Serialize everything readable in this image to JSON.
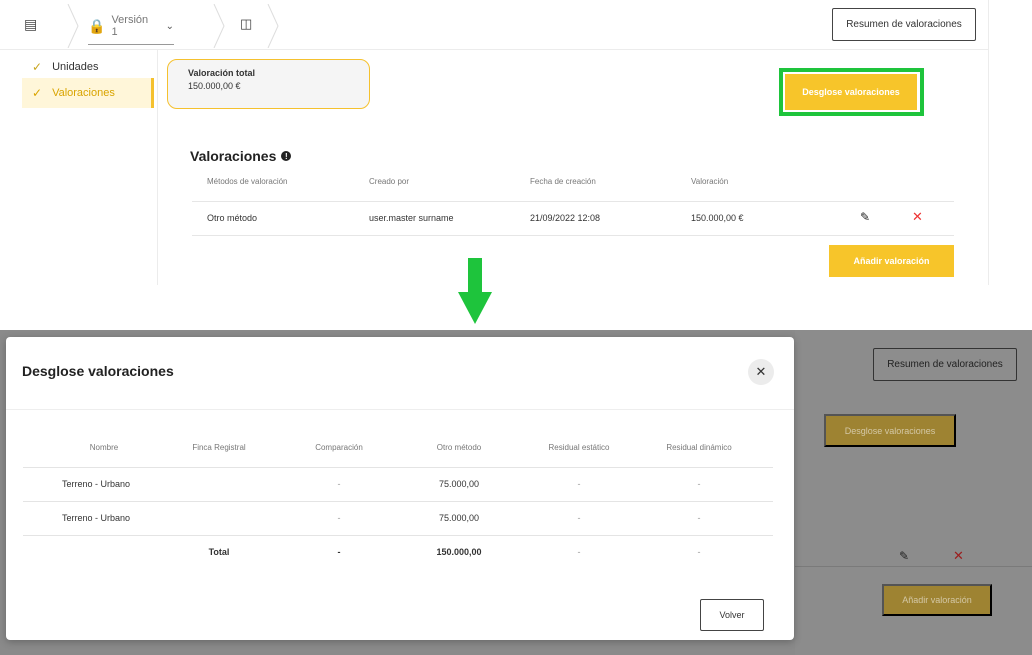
{
  "before": {
    "topbar": {
      "version_label": "Versión 1",
      "summary_button": "Resumen de valoraciones"
    },
    "sidebar": {
      "items": [
        {
          "label": "Unidades"
        },
        {
          "label": "Valoraciones"
        }
      ]
    },
    "total_card": {
      "label": "Valoración total",
      "value": "150.000,00 €"
    },
    "breakdown_button": "Desglose valoraciones",
    "section_title": "Valoraciones",
    "table": {
      "headers": [
        "Métodos de valoración",
        "Creado por",
        "Fecha de creación",
        "Valoración"
      ],
      "row": [
        "Otro método",
        "user.master surname",
        "21/09/2022 12:08",
        "150.000,00 €"
      ]
    },
    "add_button": "Añadir valoración"
  },
  "after": {
    "summary_button": "Resumen de valoraciones",
    "breakdown_button": "Desglose valoraciones",
    "add_button": "Añadir valoración",
    "modal": {
      "title": "Desglose valoraciones",
      "headers": [
        "Nombre",
        "Finca Registral",
        "Comparación",
        "Otro método",
        "Residual estático",
        "Residual dinámico"
      ],
      "rows": [
        [
          "Terreno - Urbano",
          "",
          "-",
          "75.000,00",
          "-",
          "-"
        ],
        [
          "Terreno - Urbano",
          "",
          "-",
          "75.000,00",
          "-",
          "-"
        ]
      ],
      "total_row": [
        "",
        "Total",
        "-",
        "150.000,00",
        "-",
        "-"
      ],
      "back_button": "Volver"
    }
  },
  "colors": {
    "accent_yellow": "#f7c52a",
    "highlight_green": "#1ec43c",
    "delete_red": "#e33333"
  },
  "icons": {
    "list": "list-icon",
    "lock": "lock-icon",
    "tree": "tree-icon",
    "check": "check-icon",
    "info": "info-icon",
    "edit": "pencil-icon",
    "delete": "x-icon",
    "close": "close-icon",
    "arrow": "arrow-down-icon"
  }
}
